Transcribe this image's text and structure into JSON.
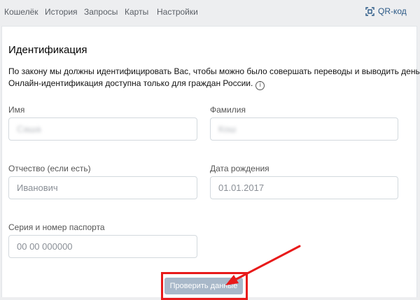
{
  "nav": {
    "items": [
      "Кошелёк",
      "История",
      "Запросы",
      "Карты",
      "Настройки"
    ],
    "qr_label": "QR-код"
  },
  "section": {
    "title": "Идентификация",
    "desc_line1": "По закону мы должны идентифицировать Вас, чтобы можно было совершать переводы и выводить деньги.",
    "desc_line2": "Онлайн-идентификация доступна только для граждан России."
  },
  "form": {
    "first_name": {
      "label": "Имя",
      "value": "Саша"
    },
    "last_name": {
      "label": "Фамилия",
      "value": "Кош"
    },
    "patronymic": {
      "label": "Отчество (если есть)",
      "placeholder": "Иванович"
    },
    "birth_date": {
      "label": "Дата рождения",
      "placeholder": "01.01.2017"
    },
    "passport": {
      "label": "Серия и номер паспорта",
      "placeholder": "00 00 000000"
    }
  },
  "submit_label": "Проверить данные",
  "colors": {
    "accent": "#2a5885",
    "button": "#a8b8c9",
    "annotation": "#e81a1a"
  }
}
